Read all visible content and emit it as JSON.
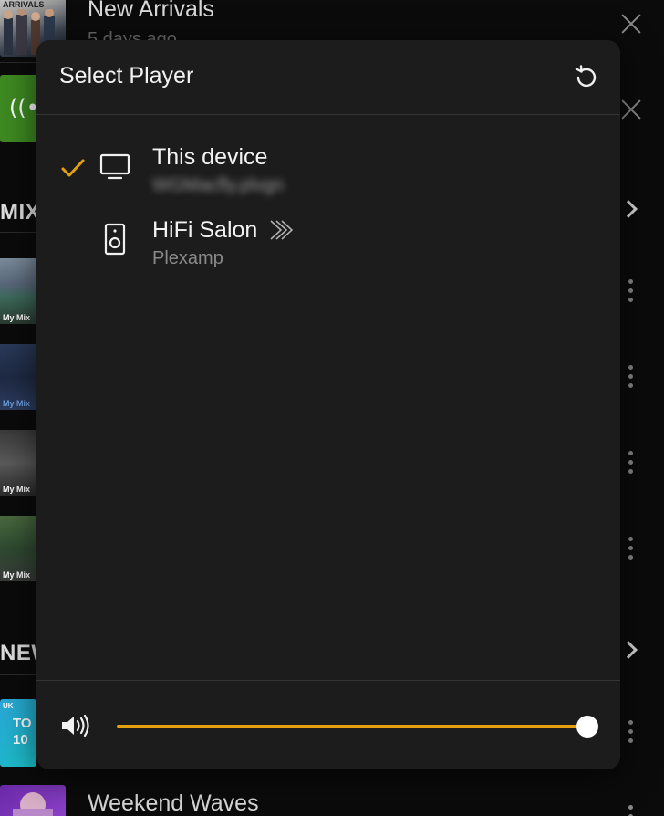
{
  "background": {
    "items": [
      {
        "title": "New Arrivals",
        "subtitle": "5 days ago",
        "thumb_label": "ARRIVALS"
      },
      {
        "title": "Weekend Waves",
        "thumb_label": ""
      }
    ],
    "sections": [
      {
        "label": "MIX"
      },
      {
        "label": "NEW"
      }
    ],
    "mix_label": "My Mix",
    "uk_tile": {
      "badge": "UK",
      "text": "TO 10"
    }
  },
  "modal": {
    "title": "Select Player",
    "players": [
      {
        "name": "This device",
        "subtitle": "WGMacfly.plvgn",
        "selected": true,
        "icon": "monitor-icon"
      },
      {
        "name": "HiFi Salon",
        "subtitle": "Plexamp",
        "selected": false,
        "icon": "speaker-icon",
        "badge_icon": "plexamp-chevron-icon"
      }
    ],
    "volume": {
      "level": 1.0,
      "icon": "volume-icon"
    }
  },
  "colors": {
    "accent": "#e5a00d",
    "modal_bg": "#1c1c1c",
    "text_primary": "#f2f2f2",
    "text_secondary": "#8a8a8a"
  }
}
